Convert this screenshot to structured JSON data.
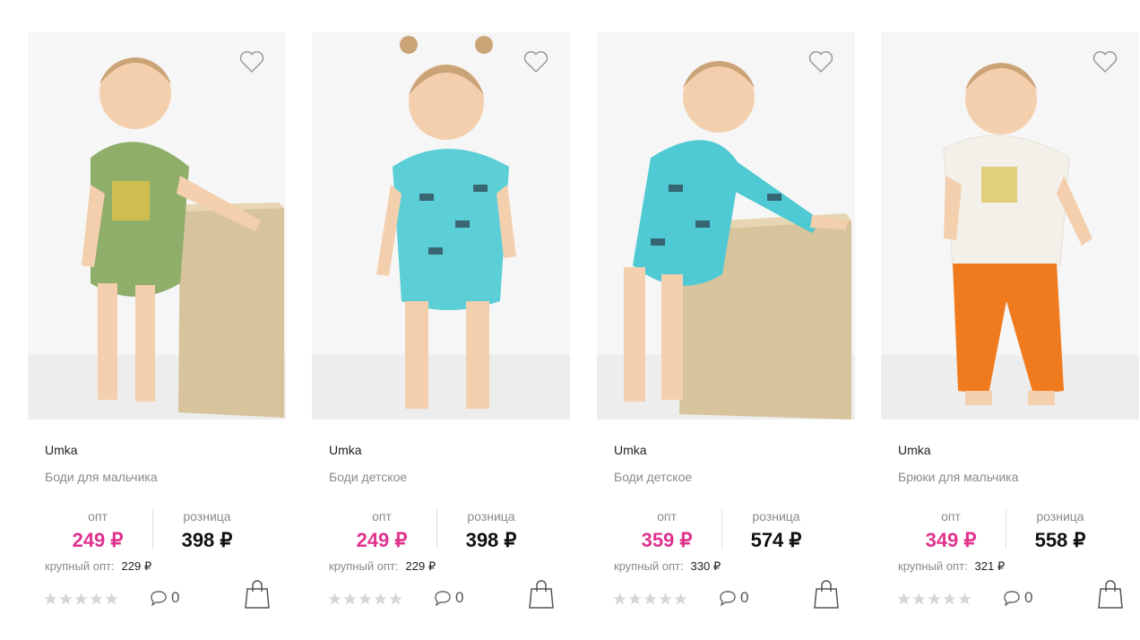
{
  "products": [
    {
      "brand": "Umka",
      "title": "Боди для мальчика",
      "opt_label": "опт",
      "opt_price": "249 ₽",
      "retail_label": "розница",
      "retail_price": "398 ₽",
      "bulk_label": "крупный опт:",
      "bulk_price": "229 ₽",
      "rating": 0,
      "comments": "0",
      "garment_color": "#8fae6a"
    },
    {
      "brand": "Umka",
      "title": "Боди детское",
      "opt_label": "опт",
      "opt_price": "249 ₽",
      "retail_label": "розница",
      "retail_price": "398 ₽",
      "bulk_label": "крупный опт:",
      "bulk_price": "229 ₽",
      "rating": 0,
      "comments": "0",
      "garment_color": "#5ccfd6"
    },
    {
      "brand": "Umka",
      "title": "Боди детское",
      "opt_label": "опт",
      "opt_price": "359 ₽",
      "retail_label": "розница",
      "retail_price": "574 ₽",
      "bulk_label": "крупный опт:",
      "bulk_price": "330 ₽",
      "rating": 0,
      "comments": "0",
      "garment_color": "#4fc9d3"
    },
    {
      "brand": "Umka",
      "title": "Брюки для мальчика",
      "opt_label": "опт",
      "opt_price": "349 ₽",
      "retail_label": "розница",
      "retail_price": "558 ₽",
      "bulk_label": "крупный опт:",
      "bulk_price": "321 ₽",
      "rating": 0,
      "comments": "0",
      "garment_color": "#f2f0e8",
      "pants_color": "#f07a1e"
    }
  ],
  "colors": {
    "accent_price": "#e0338e",
    "muted_text": "#8a8a8a",
    "star_empty": "#d6d6d6"
  },
  "icons": {
    "favorite": "heart-outline-icon",
    "comments": "speech-bubble-icon",
    "cart": "shopping-bag-icon",
    "rating": "star-icon"
  }
}
